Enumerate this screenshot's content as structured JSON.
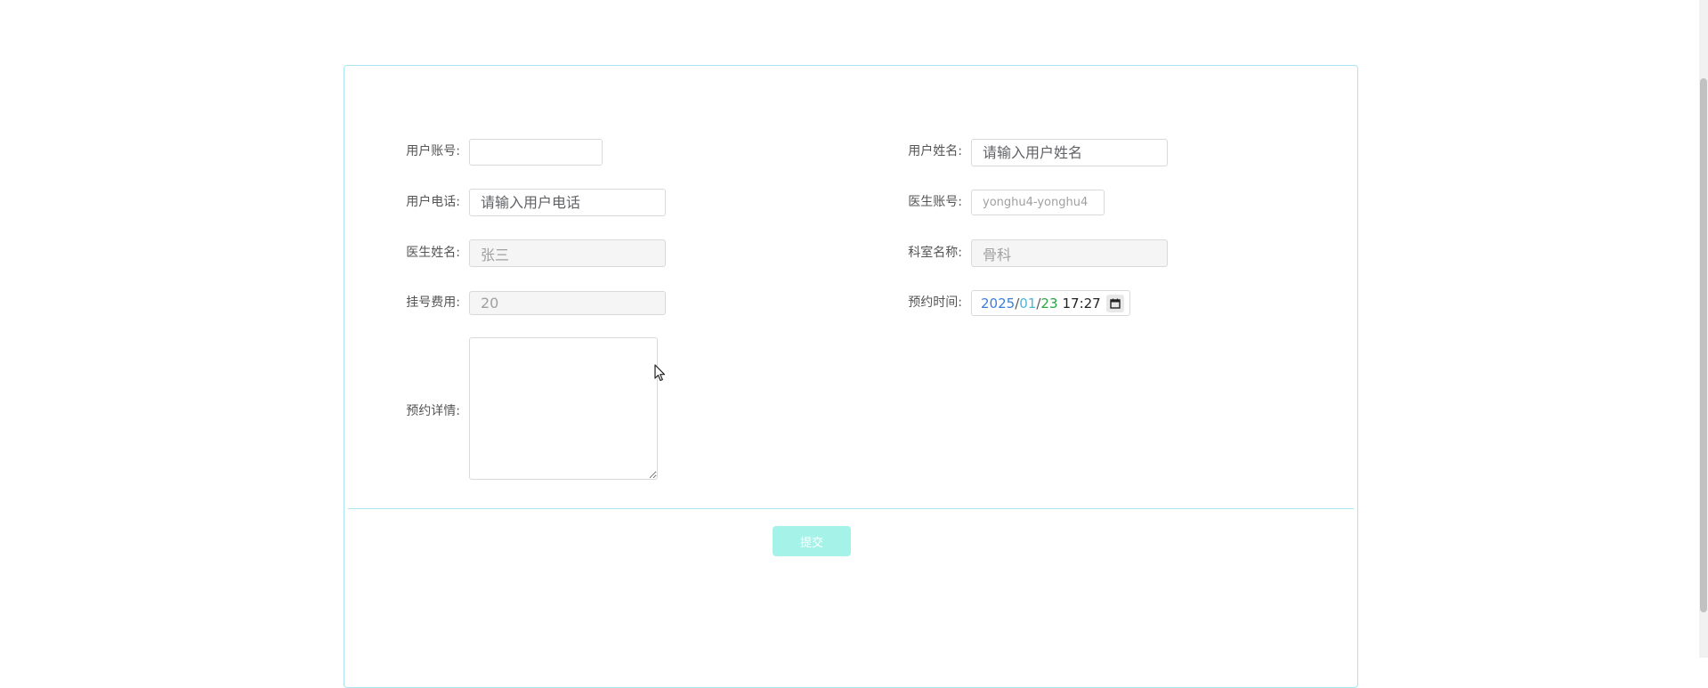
{
  "form": {
    "account": {
      "label": "用户账号:",
      "value": "",
      "placeholder": ""
    },
    "name": {
      "label": "用户姓名:",
      "value": "",
      "placeholder": "请输入用户姓名"
    },
    "phone": {
      "label": "用户电话:",
      "value": "",
      "placeholder": "请输入用户电话"
    },
    "doctor_account": {
      "label": "医生账号:",
      "value": "yonghu4-yonghu4"
    },
    "doctor_name": {
      "label": "医生姓名:",
      "value": "张三"
    },
    "department": {
      "label": "科室名称:",
      "value": "骨科"
    },
    "fee": {
      "label": "挂号费用:",
      "value": "20"
    },
    "appointment_time": {
      "label": "预约时间:",
      "year": "2025",
      "month": "01",
      "day": "23",
      "time": "17:27"
    },
    "details": {
      "label": "预约详情:",
      "value": ""
    },
    "submit_label": "提交"
  },
  "icons": {
    "calendar": "calendar-icon",
    "cursor": "mouse-pointer-icon"
  },
  "colors": {
    "border": "#a8e6ef",
    "submit_bg": "#a5f3e8"
  }
}
